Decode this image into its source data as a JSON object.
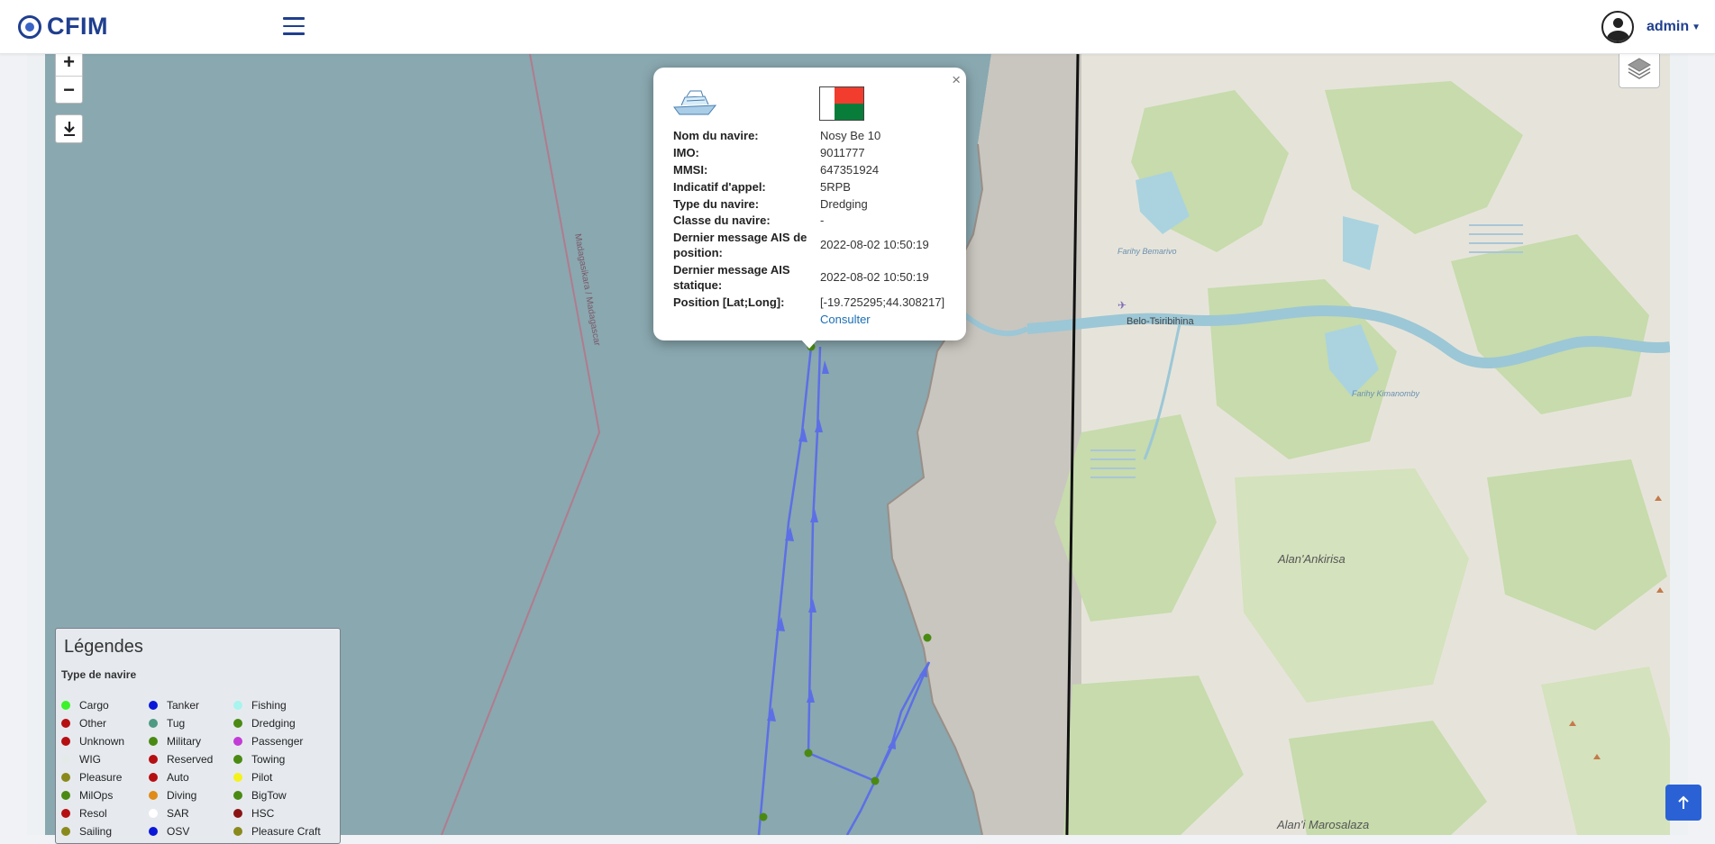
{
  "header": {
    "brand": "CFIM",
    "user": "admin"
  },
  "map": {
    "labels": {
      "city": "Belo-Tsiribihina",
      "lake1": "Farihy Bemarivo",
      "lake2": "Farihy Kimanomby",
      "region1": "Alan'Ankirisa",
      "region2": "Alan'i Marosalaza",
      "boundary": "Madagasikara / Madagascar"
    }
  },
  "popup": {
    "fields": [
      {
        "label": "Nom du navire:",
        "value": "Nosy Be 10"
      },
      {
        "label": "IMO:",
        "value": "9011777"
      },
      {
        "label": "MMSI:",
        "value": "647351924"
      },
      {
        "label": "Indicatif d'appel:",
        "value": "5RPB"
      },
      {
        "label": "Type du navire:",
        "value": "Dredging"
      },
      {
        "label": "Classe du navire:",
        "value": "-"
      },
      {
        "label": "Dernier message AIS de position:",
        "value": "2022-08-02 10:50:19"
      },
      {
        "label": "Dernier message AIS statique:",
        "value": "2022-08-02 10:50:19"
      },
      {
        "label": "Position [Lat;Long]:",
        "value": "[-19.725295;44.308217]"
      }
    ],
    "link": "Consulter",
    "close": "×",
    "flag_colors": {
      "white": "#ffffff",
      "red": "#f23c2e",
      "green": "#087d3a"
    }
  },
  "legend": {
    "title": "Légendes",
    "subtitle": "Type de navire",
    "items": [
      {
        "label": "Cargo",
        "color": "#3cf22a"
      },
      {
        "label": "Other",
        "color": "#b50f12"
      },
      {
        "label": "Unknown",
        "color": "#b50f12"
      },
      {
        "label": "WIG",
        "color": "#e4eae8"
      },
      {
        "label": "Pleasure",
        "color": "#8a8a1c"
      },
      {
        "label": "MilOps",
        "color": "#4a8a12"
      },
      {
        "label": "Resol",
        "color": "#b50f12"
      },
      {
        "label": "Sailing",
        "color": "#8a8a1c"
      },
      {
        "label": "Tanker",
        "color": "#0a17d8"
      },
      {
        "label": "Tug",
        "color": "#4e9a82"
      },
      {
        "label": "Military",
        "color": "#4a8a12"
      },
      {
        "label": "Reserved",
        "color": "#b50f12"
      },
      {
        "label": "Auto",
        "color": "#b50f12"
      },
      {
        "label": "Diving",
        "color": "#e08a18"
      },
      {
        "label": "SAR",
        "color": "#ffffff"
      },
      {
        "label": "OSV",
        "color": "#0a17d8"
      },
      {
        "label": "Fishing",
        "color": "#a8f4ee"
      },
      {
        "label": "Dredging",
        "color": "#4a8a12"
      },
      {
        "label": "Passenger",
        "color": "#c23cd6"
      },
      {
        "label": "Towing",
        "color": "#4a8a12"
      },
      {
        "label": "Pilot",
        "color": "#f4f21a"
      },
      {
        "label": "BigTow",
        "color": "#4a8a12"
      },
      {
        "label": "HSC",
        "color": "#8a1414"
      },
      {
        "label": "Pleasure Craft",
        "color": "#8a8a1c"
      }
    ]
  },
  "colors": {
    "accent": "#1f3f8f",
    "track": "#5c6fe6",
    "ship_dot": "#4a8a12",
    "sea": "#8aa8b0",
    "land": "#ecebe3",
    "forest": "#c8dcae",
    "scroll_button": "#2a62d6"
  },
  "icons": {
    "zoom_in": "+",
    "zoom_out": "−",
    "download": "download-icon",
    "layers": "layers-icon",
    "scroll_top": "arrow-up-icon"
  }
}
